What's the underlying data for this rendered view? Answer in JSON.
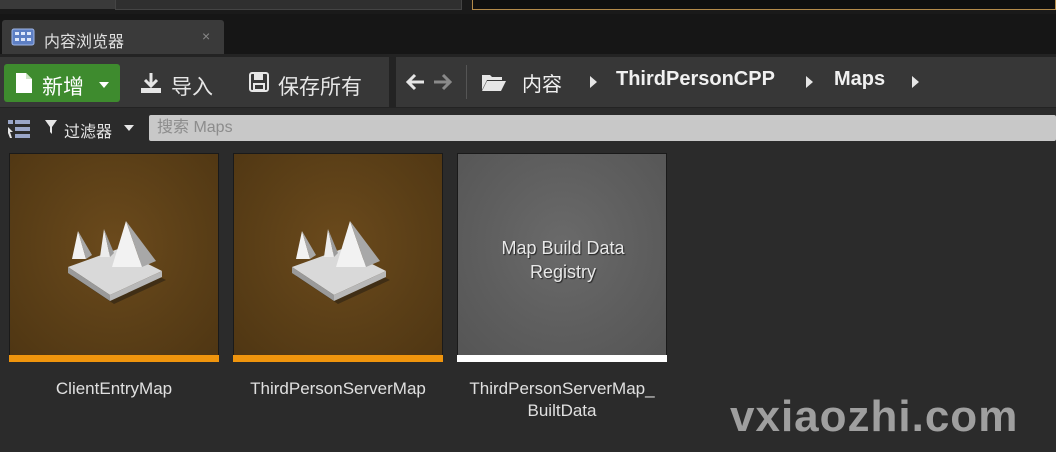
{
  "tab": {
    "title": "内容浏览器",
    "close": "×"
  },
  "toolbar": {
    "new_label": "新增",
    "import_label": "导入",
    "save_all_label": "保存所有"
  },
  "breadcrumb": [
    "内容",
    "ThirdPersonCPP",
    "Maps"
  ],
  "filter": {
    "label": "过滤器",
    "search_placeholder": "搜索 Maps"
  },
  "assets": [
    {
      "name": "ClientEntryMap",
      "type": "map",
      "stripe_color": "#f0950d"
    },
    {
      "name": "ThirdPersonServerMap",
      "type": "map",
      "stripe_color": "#f0950d"
    },
    {
      "name": "ThirdPersonServerMap_\nBuiltData",
      "type": "data",
      "thumb_text": "Map Build Data\nRegistry",
      "stripe_color": "#ffffff"
    }
  ],
  "watermark": "vxiaozhi.com",
  "colors": {
    "new_button": "#3e8b2e",
    "map_stripe": "#f0950d",
    "data_stripe": "#ffffff"
  }
}
